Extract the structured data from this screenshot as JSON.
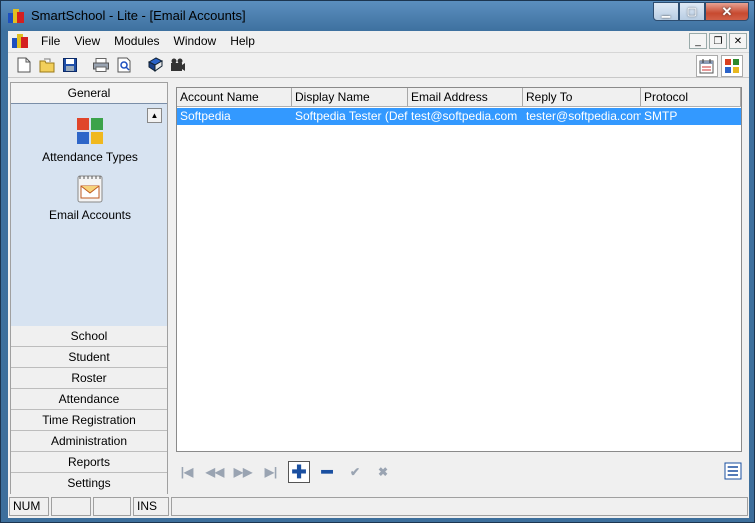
{
  "window": {
    "title": "SmartSchool - Lite - [Email Accounts]",
    "caption_buttons": [
      "minimize",
      "maximize",
      "close"
    ]
  },
  "menubar": {
    "items": [
      "File",
      "View",
      "Modules",
      "Window",
      "Help"
    ]
  },
  "toolbar": {
    "buttons": [
      "new-icon",
      "open-icon",
      "save-icon",
      "print-icon",
      "print-preview-icon",
      "book-icon",
      "camera-icon"
    ],
    "right_buttons": [
      "calendar-icon",
      "modules-icon"
    ]
  },
  "sidebar": {
    "active_group": "General",
    "items": [
      {
        "label": "Attendance Types",
        "icon": "attendance-types-icon"
      },
      {
        "label": "Email Accounts",
        "icon": "email-accounts-icon"
      }
    ],
    "groups": [
      "School",
      "Student",
      "Roster",
      "Attendance",
      "Time Registration",
      "Administration",
      "Reports",
      "Settings"
    ]
  },
  "table": {
    "columns": [
      "Account Name",
      "Display Name",
      "Email Address",
      "Reply To",
      "Protocol"
    ],
    "rows": [
      [
        "Softpedia",
        "Softpedia Tester (Default)",
        "test@softpedia.com",
        "tester@softpedia.com",
        "SMTP"
      ]
    ]
  },
  "navigator": {
    "buttons": [
      "first",
      "prior",
      "next",
      "last",
      "insert",
      "delete",
      "post",
      "cancel"
    ]
  },
  "statusbar": {
    "panels": [
      "NUM",
      "",
      "",
      "INS",
      ""
    ]
  },
  "colors": {
    "selection": "#3399ff",
    "sidebar_body": "#d7e3f1",
    "frame": "#3e719f"
  }
}
